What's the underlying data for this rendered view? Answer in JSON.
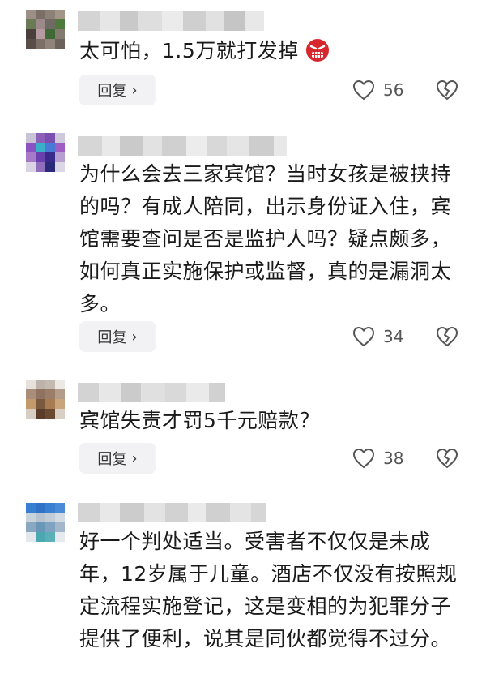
{
  "comments": [
    {
      "text": "太可怕，1.5万就打发掉",
      "emoji": "angry-face-emoji",
      "reply_label": "回复",
      "likes": "56"
    },
    {
      "text": "为什么会去三家宾馆？当时女孩是被挟持的吗？有成人陪同，出示身份证入住，宾馆需要查问是否是监护人吗？疑点颇多，如何真正实施保护或监督，真的是漏洞太多。",
      "reply_label": "回复",
      "likes": "34"
    },
    {
      "text": "宾馆失责才罚5千元赔款？",
      "reply_label": "回复",
      "likes": "38"
    },
    {
      "text": "好一个判处适当。受害者不仅仅是未成年，12岁属于儿童。酒店不仅没有按照规定流程实施登记，这是变相的为犯罪分子提供了便利，说其是同伙都觉得不过分。"
    }
  ],
  "icons": {
    "like": "heart-outline-icon",
    "dislike": "broken-heart-icon",
    "reply_chevron": "chevron-right-icon"
  },
  "colors": {
    "background": "#ffffff",
    "reply_bg": "#f2f2f4",
    "icon_gray": "#555555"
  }
}
